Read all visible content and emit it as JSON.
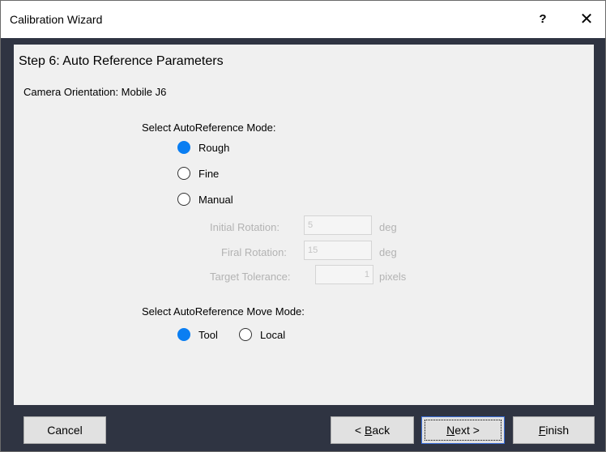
{
  "window": {
    "title": "Calibration Wizard",
    "help_glyph": "?",
    "close_glyph": "✕"
  },
  "step": {
    "title": "Step 6: Auto Reference Parameters",
    "orientation": "Camera Orientation: Mobile J6"
  },
  "mode": {
    "label": "Select AutoReference Mode:",
    "options": [
      {
        "label": "Rough",
        "checked": true
      },
      {
        "label": "Fine",
        "checked": false
      },
      {
        "label": "Manual",
        "checked": false
      }
    ]
  },
  "manual": {
    "initial_rotation": {
      "label": "Initial Rotation:",
      "value": "5",
      "unit": "deg"
    },
    "final_rotation": {
      "label": "Firal Rotation:",
      "value": "15",
      "unit": "deg"
    },
    "target_tolerance": {
      "label": "Target Tolerance:",
      "value": "1",
      "unit": "pixels"
    }
  },
  "move_mode": {
    "label": "Select AutoReference Move Mode:",
    "options": [
      {
        "label": "Tool",
        "checked": true
      },
      {
        "label": "Local",
        "checked": false
      }
    ]
  },
  "buttons": {
    "cancel": "Cancel",
    "back_prefix": "< ",
    "back_key": "B",
    "back_rest": "ack",
    "next_key": "N",
    "next_rest": "ext >",
    "finish_key": "F",
    "finish_rest": "inish"
  },
  "colors": {
    "accent": "#0a7ef2",
    "footer": "#2f3442",
    "panel": "#f0f0f0"
  }
}
